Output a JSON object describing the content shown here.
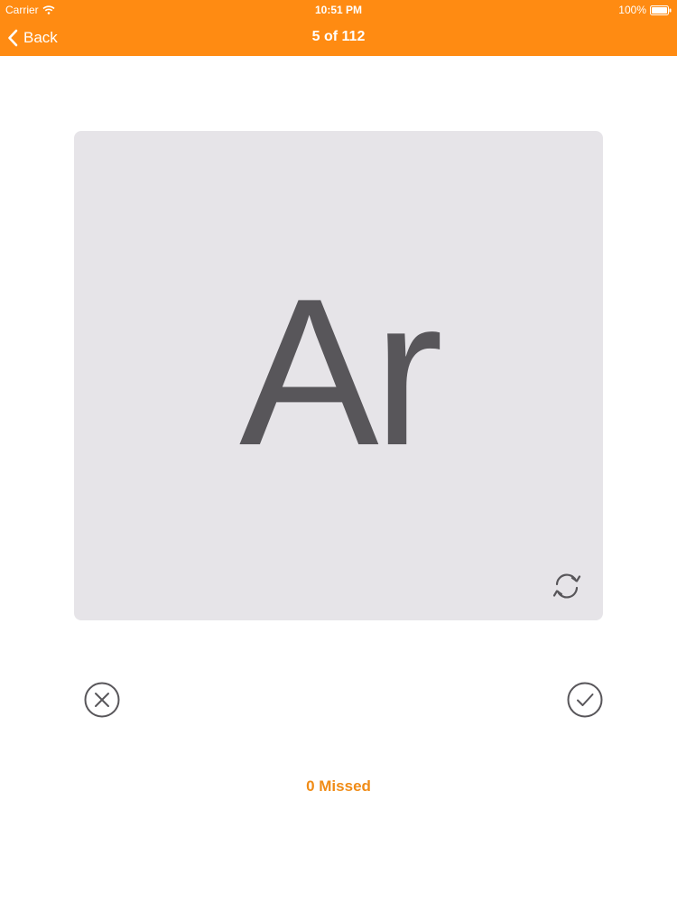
{
  "status_bar": {
    "carrier": "Carrier",
    "time": "10:51 PM",
    "battery": "100%"
  },
  "nav": {
    "back_label": "Back",
    "title": "5 of 112"
  },
  "card": {
    "text": "Ar",
    "flip_icon": "refresh-icon"
  },
  "actions": {
    "miss_icon": "close-circle-icon",
    "correct_icon": "check-circle-icon"
  },
  "footer": {
    "missed_text": "0 Missed"
  },
  "colors": {
    "accent": "#ff8b12",
    "missed_text": "#f08c17",
    "card_background": "#e6e4e8",
    "card_text": "#58565a",
    "icon": "#58565a"
  }
}
